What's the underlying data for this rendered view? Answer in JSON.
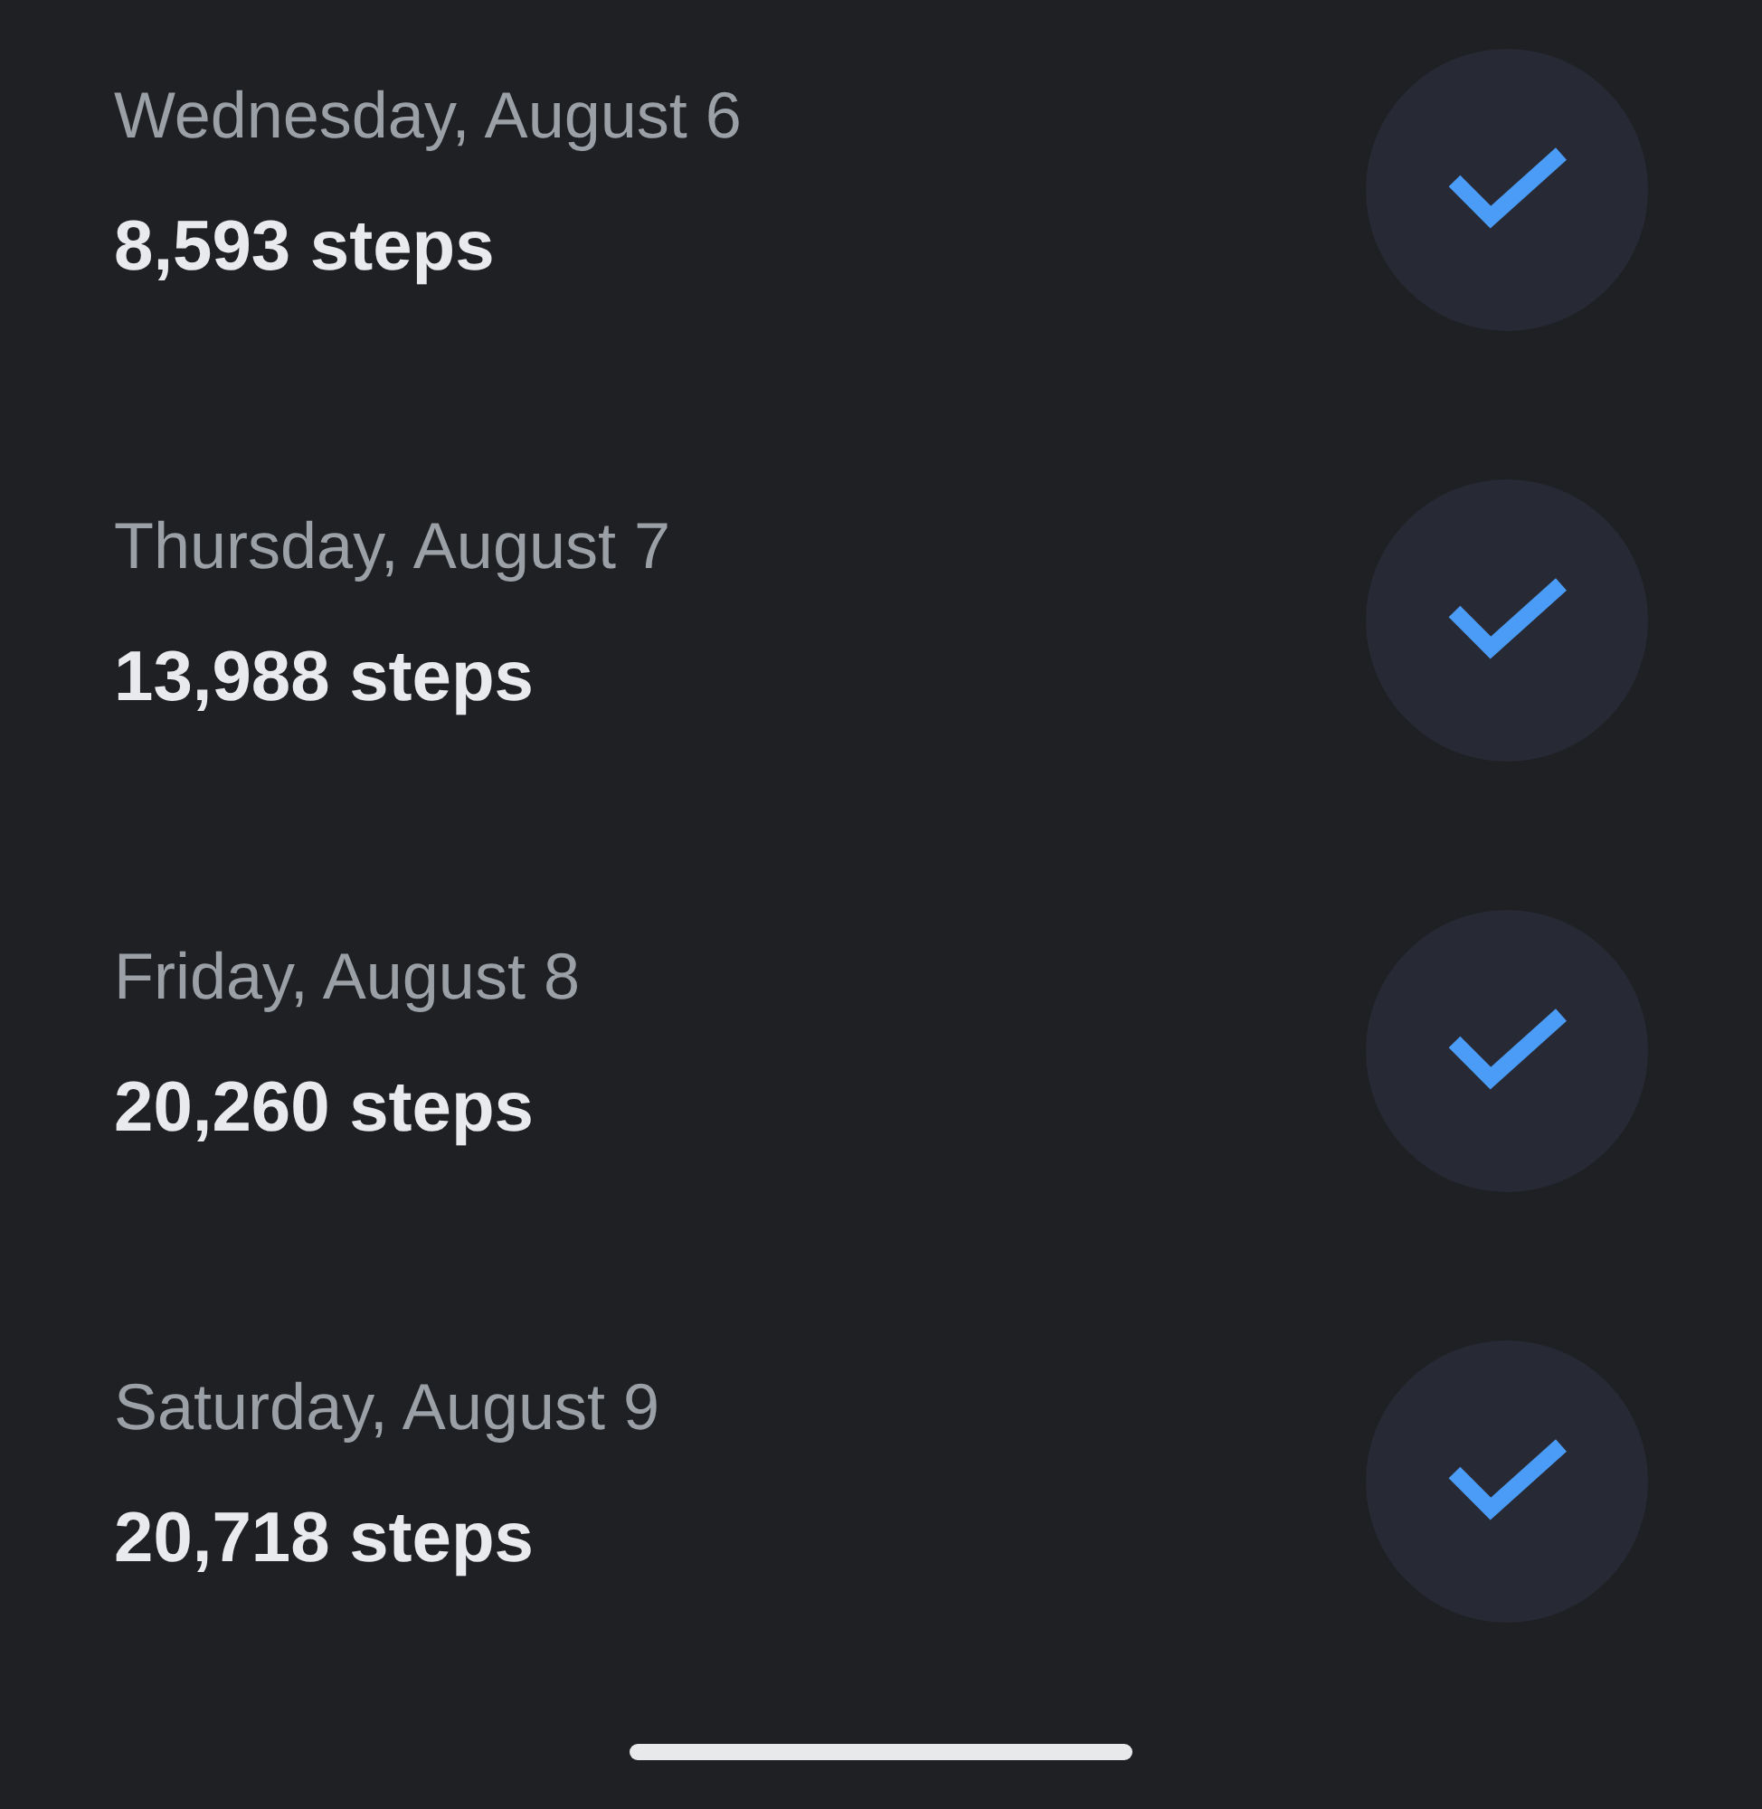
{
  "days": [
    {
      "date": "Wednesday, August 6",
      "steps": "8,593 steps",
      "checked": true
    },
    {
      "date": "Thursday, August 7",
      "steps": "13,988 steps",
      "checked": true
    },
    {
      "date": "Friday, August 8",
      "steps": "20,260 steps",
      "checked": true
    },
    {
      "date": "Saturday, August 9",
      "steps": "20,718 steps",
      "checked": true
    }
  ]
}
